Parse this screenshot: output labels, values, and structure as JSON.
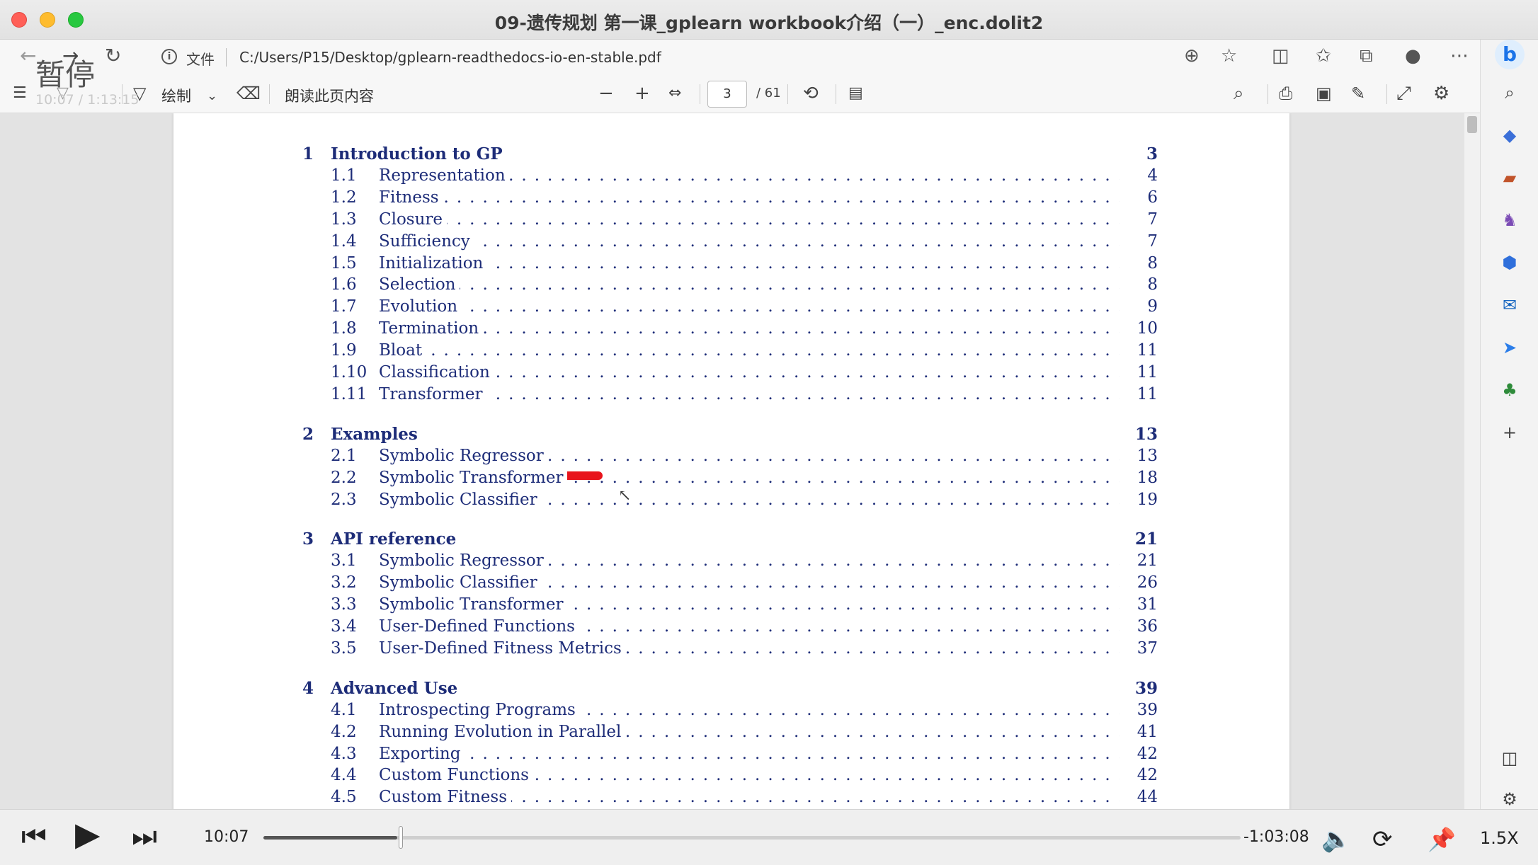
{
  "window": {
    "title": "09-遗传规划 第一课_gplearn workbook介绍（一）_enc.dolit2"
  },
  "address_bar": {
    "file_label": "文件",
    "url": "C:/Users/P15/Desktop/gplearn-readthedocs-io-en-stable.pdf"
  },
  "pdf_toolbar": {
    "draw_label": "绘制",
    "read_aloud_label": "朗读此页内容",
    "current_page": "3",
    "total_pages": "/ 61"
  },
  "overlay": {
    "paused_label": "暂停",
    "timestamp": "10:07 / 1:13:15"
  },
  "toc": [
    {
      "num": "1",
      "title": "Introduction to GP",
      "page": "3",
      "sections": [
        {
          "num": "1.1",
          "title": "Representation",
          "page": "4"
        },
        {
          "num": "1.2",
          "title": "Fitness",
          "page": "6"
        },
        {
          "num": "1.3",
          "title": "Closure",
          "page": "7"
        },
        {
          "num": "1.4",
          "title": "Sufficiency",
          "page": "7"
        },
        {
          "num": "1.5",
          "title": "Initialization",
          "page": "8"
        },
        {
          "num": "1.6",
          "title": "Selection",
          "page": "8"
        },
        {
          "num": "1.7",
          "title": "Evolution",
          "page": "9"
        },
        {
          "num": "1.8",
          "title": "Termination",
          "page": "10"
        },
        {
          "num": "1.9",
          "title": "Bloat",
          "page": "11"
        },
        {
          "num": "1.10",
          "title": "Classification",
          "page": "11"
        },
        {
          "num": "1.11",
          "title": "Transformer",
          "page": "11"
        }
      ]
    },
    {
      "num": "2",
      "title": "Examples",
      "page": "13",
      "sections": [
        {
          "num": "2.1",
          "title": "Symbolic Regressor",
          "page": "13"
        },
        {
          "num": "2.2",
          "title": "Symbolic Transformer",
          "page": "18"
        },
        {
          "num": "2.3",
          "title": "Symbolic Classifier",
          "page": "19"
        }
      ]
    },
    {
      "num": "3",
      "title": "API reference",
      "page": "21",
      "sections": [
        {
          "num": "3.1",
          "title": "Symbolic Regressor",
          "page": "21"
        },
        {
          "num": "3.2",
          "title": "Symbolic Classifier",
          "page": "26"
        },
        {
          "num": "3.3",
          "title": "Symbolic Transformer",
          "page": "31"
        },
        {
          "num": "3.4",
          "title": "User-Defined Functions",
          "page": "36"
        },
        {
          "num": "3.5",
          "title": "User-Defined Fitness Metrics",
          "page": "37"
        }
      ]
    },
    {
      "num": "4",
      "title": "Advanced Use",
      "page": "39",
      "sections": [
        {
          "num": "4.1",
          "title": "Introspecting Programs",
          "page": "39"
        },
        {
          "num": "4.2",
          "title": "Running Evolution in Parallel",
          "page": "41"
        },
        {
          "num": "4.3",
          "title": "Exporting",
          "page": "42"
        },
        {
          "num": "4.4",
          "title": "Custom Functions",
          "page": "42"
        },
        {
          "num": "4.5",
          "title": "Custom Fitness",
          "page": "44"
        }
      ]
    }
  ],
  "player": {
    "current_time": "10:07",
    "remaining_time": "-1:03:08",
    "speed": "1.5X",
    "progress_fraction": 0.137
  },
  "colors": {
    "toc_text": "#1d2c78",
    "annotation": "#e8141c"
  }
}
